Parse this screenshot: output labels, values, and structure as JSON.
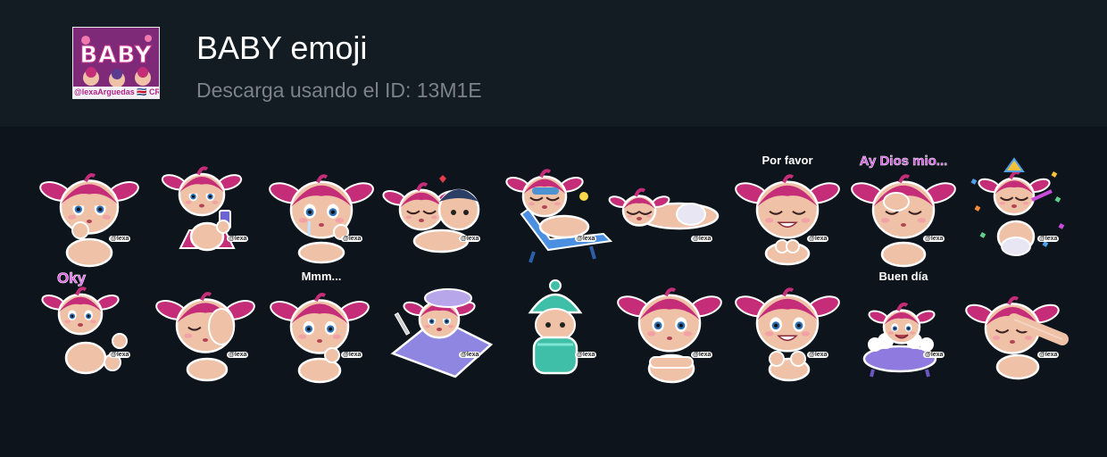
{
  "header": {
    "title": "BABY emoji",
    "subtitle": "Descarga usando el ID: 13M1E",
    "thumbnail": {
      "title": "BABY",
      "credit": "@lexaArguedas 🇨🇷 CR"
    }
  },
  "colors": {
    "header_bg": "#131b23",
    "page_bg": "#0d141b",
    "hair": "#c52d78",
    "skin": "#efc1a6",
    "caption_pink": "#d548e6"
  },
  "watermark": "@lexa",
  "stickers": [
    {
      "name": "sticker-chin-thinking",
      "caption": "",
      "pose": "chin"
    },
    {
      "name": "sticker-phone-tutu",
      "caption": "",
      "pose": "phone"
    },
    {
      "name": "sticker-teary-eyes",
      "caption": "",
      "pose": "teary"
    },
    {
      "name": "sticker-kiss-boy",
      "caption": "",
      "pose": "kiss"
    },
    {
      "name": "sticker-beach-chair",
      "caption": "",
      "pose": "beach"
    },
    {
      "name": "sticker-lying-down",
      "caption": "",
      "pose": "lying"
    },
    {
      "name": "sticker-por-favor",
      "caption": "Por favor",
      "pose": "please"
    },
    {
      "name": "sticker-ay-dios-mio",
      "caption": "Ay Dios mio...",
      "pose": "facepalm"
    },
    {
      "name": "sticker-party",
      "caption": "",
      "pose": "party"
    },
    {
      "name": "sticker-oky",
      "caption": "Oky",
      "pose": "oky"
    },
    {
      "name": "sticker-hand-face",
      "caption": "",
      "pose": "handface"
    },
    {
      "name": "sticker-mmm",
      "caption": "Mmm...",
      "pose": "mmm"
    },
    {
      "name": "sticker-sick-bed",
      "caption": "",
      "pose": "sick"
    },
    {
      "name": "sticker-cold-winter",
      "caption": "",
      "pose": "cold"
    },
    {
      "name": "sticker-arms-crossed",
      "caption": "",
      "pose": "crossed"
    },
    {
      "name": "sticker-grin",
      "caption": "",
      "pose": "grin"
    },
    {
      "name": "sticker-buen-dia",
      "caption": "Buen día",
      "pose": "bath"
    },
    {
      "name": "sticker-dab",
      "caption": "",
      "pose": "dab"
    }
  ]
}
